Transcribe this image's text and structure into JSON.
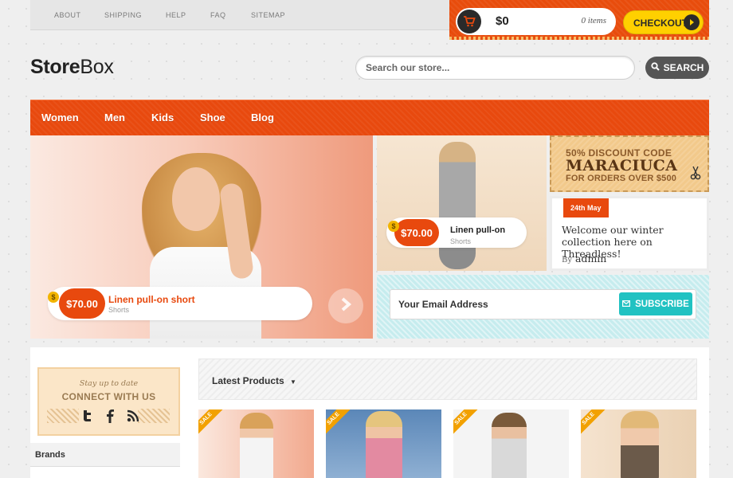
{
  "top_links": [
    "ABOUT",
    "SHIPPING",
    "HELP",
    "FAQ",
    "SITEMAP"
  ],
  "cart": {
    "amount": "$0",
    "items": "0 items",
    "checkout_label": "CHECKOUT"
  },
  "logo": {
    "bold": "Store",
    "light": "Box"
  },
  "search": {
    "placeholder": "Search our store...",
    "button_label": "SEARCH"
  },
  "nav": [
    "Women",
    "Men",
    "Kids",
    "Shoe",
    "Blog"
  ],
  "hero": {
    "coin": "$",
    "price": "$70.00",
    "title": "Linen pull-on short",
    "category": "Shorts"
  },
  "feature": {
    "coin": "$",
    "price": "$70.00",
    "title": "Linen pull-on",
    "category": "Shorts"
  },
  "coupon": {
    "line1": "50% DISCOUNT CODE",
    "code": "MARACIUCA",
    "line3": "FOR ORDERS OVER $500"
  },
  "news": {
    "date": "24th May",
    "text": "Welcome our winter collection here on Threadless!",
    "by": "By",
    "author": "admin"
  },
  "newsletter": {
    "placeholder": "Your Email Address",
    "button_label": "SUBSCRIBE"
  },
  "social_box": {
    "tagline": "Stay up to date",
    "title": "CONNECT WITH US"
  },
  "sidebar": {
    "brands": "Brands"
  },
  "products": {
    "heading": "Latest Products",
    "sale_label": "SALE"
  },
  "colors": {
    "brand_orange": "#e8490e",
    "checkout_yellow": "#ffd000",
    "subscribe_teal": "#21c2c2"
  }
}
